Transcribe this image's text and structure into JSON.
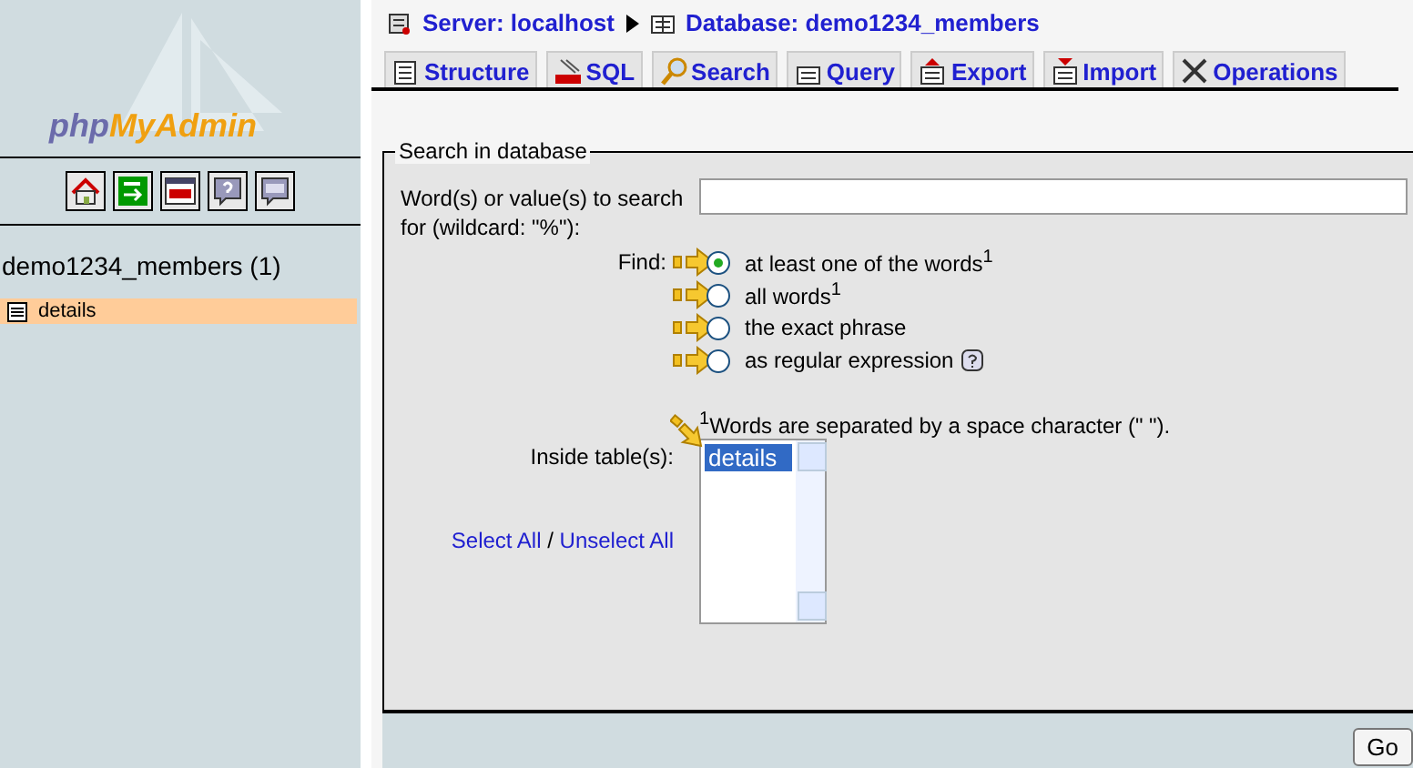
{
  "sidebar": {
    "logo": {
      "prefix": "php",
      "suffix": "MyAdmin"
    },
    "toolbar": [
      {
        "kind": "home"
      },
      {
        "kind": "exit"
      },
      {
        "kind": "sql"
      },
      {
        "kind": "help"
      },
      {
        "kind": "query"
      }
    ],
    "database": "demo1234_members (1)",
    "tables": [
      {
        "name": "details",
        "selected": true
      }
    ]
  },
  "breadcrumb": [
    {
      "kind": "server",
      "label": "Server: localhost"
    },
    {
      "kind": "database",
      "label": "Database: demo1234_members"
    }
  ],
  "tabs": [
    {
      "kind": "structure",
      "label": "Structure",
      "selected": false
    },
    {
      "kind": "sql",
      "label": "SQL",
      "selected": false
    },
    {
      "kind": "search",
      "label": "Search",
      "selected": false
    },
    {
      "kind": "query",
      "label": "Query",
      "selected": false
    },
    {
      "kind": "export",
      "label": "Export",
      "selected": false
    },
    {
      "kind": "import",
      "label": "Import",
      "selected": false
    },
    {
      "kind": "operations",
      "label": "Operations",
      "selected": false
    }
  ],
  "form": {
    "legend": "Search in database",
    "search_label": "Word(s) or value(s) to search for (wildcard: \"%\"):",
    "find_label": "Find:",
    "options": [
      {
        "label": "at least one of the words$^{1}$",
        "selected": true,
        "help": false,
        "pointed": true
      },
      {
        "label": "all words$^{1}$",
        "selected": false,
        "help": false,
        "pointed": true
      },
      {
        "label": "the exact phrase",
        "selected": false,
        "help": false,
        "pointed": true
      },
      {
        "label": "as regular expression",
        "selected": false,
        "help": true,
        "pointed": true
      }
    ],
    "footnote": "$^{1}$Words are separated by a space character (\" \").",
    "tables_label": "Inside table(s):",
    "table_list": {
      "pointed": true,
      "items": [
        {
          "name": "details",
          "selected": true
        }
      ]
    },
    "select_all": "Select All",
    "separator": "/",
    "unselect_all": "Unselect All",
    "go": "Go"
  }
}
